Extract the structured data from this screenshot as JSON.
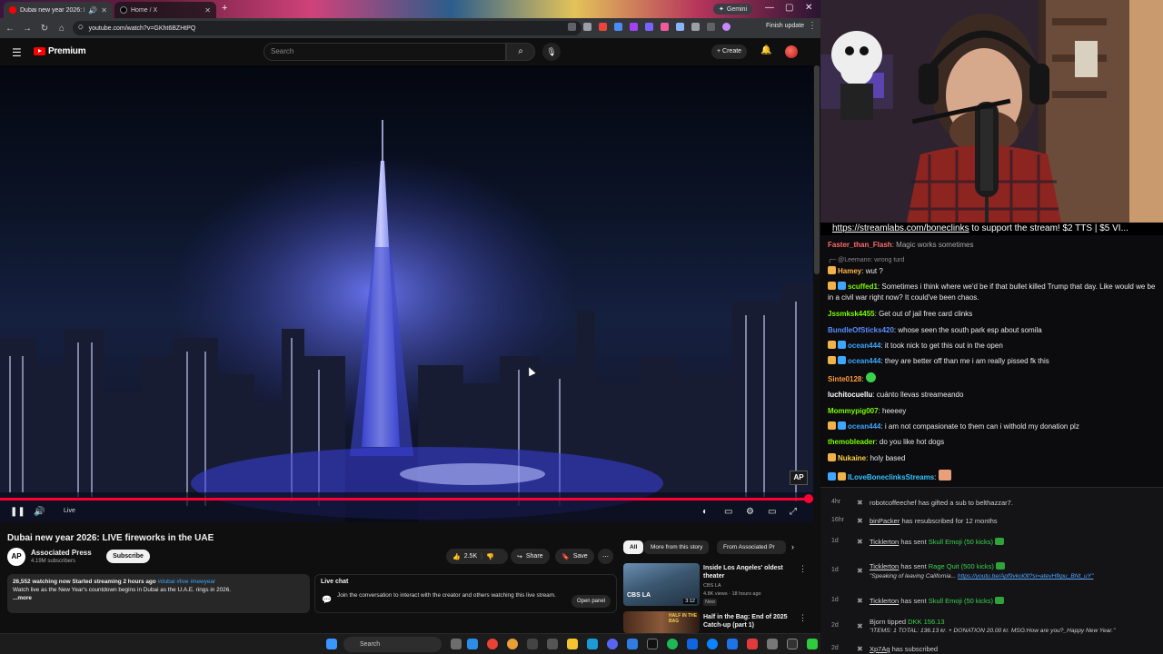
{
  "browser": {
    "tabs": [
      {
        "title": "Dubai new year 2026: LIVE"
      },
      {
        "title": "Home / X"
      }
    ],
    "gemini_label": "Gemini",
    "url": "youtube.com/watch?v=GKht6BZHtPQ",
    "finish_update": "Finish update"
  },
  "youtube": {
    "brand": "Premium",
    "search_placeholder": "Search",
    "create_label": "Create",
    "video": {
      "title": "Dubai new year 2026: LIVE fireworks in the UAE",
      "live_label": "Live",
      "watermark": "AP",
      "progress_fraction": 1.0
    },
    "channel": {
      "avatar_text": "AP",
      "name": "Associated Press",
      "subscribers": "4.19M subscribers",
      "subscribe_label": "Subscribe"
    },
    "actions": {
      "likes": "2.5K",
      "share": "Share",
      "save": "Save"
    },
    "description": {
      "meta": "26,552 watching now  Started streaming 2 hours ago",
      "tags": "#dubai #live #newyear",
      "text": "Watch live as the New Year's countdown begins in Dubai as the U.A.E. rings in 2026.",
      "more": "...more"
    },
    "live_chat": {
      "title": "Live chat",
      "text": "Join the conversation to interact with the creator and others watching this live stream.",
      "open_panel": "Open panel"
    },
    "chips": [
      "All",
      "More from this story",
      "From Associated Pr"
    ],
    "recommendations": [
      {
        "title": "Inside Los Angeles' oldest theater",
        "channel": "CBS LA",
        "meta": "4.8K views · 18 hours ago",
        "badge": "New",
        "duration": "3:12",
        "thumb_text": "CBS LA"
      },
      {
        "title": "Half in the Bag: End of 2025 Catch-up (part 1)",
        "thumb_text": "HALF IN THE BAG"
      }
    ]
  },
  "stream": {
    "ticker_link": "https://streamlabs.com/boneclinks",
    "ticker_text": " to support the stream! $2 TTS | $5 VI..."
  },
  "chat": {
    "messages": [
      {
        "user": "Faster_than_Flash",
        "text": "Magic works sometimes",
        "color": "#ff6b6b"
      },
      {
        "reply": "@Leemann: wrong turd"
      },
      {
        "user": "Hamey",
        "text": "wut ?",
        "color": "#ffb347"
      },
      {
        "user": "scuffed1",
        "text": "Sometimes i think where we'd be if that bullet killed Trump that day. Like would we be in a civil war right now? It could've been chaos.",
        "color": "#7cfc00"
      },
      {
        "user": "Jssmksk4455",
        "text": "Get out of jail free card clinks",
        "color": "#7cfc00"
      },
      {
        "user": "BundleOfSticks420",
        "text": "whose seen the south park esp about somila",
        "color": "#5b8cff"
      },
      {
        "user": "ocean444",
        "text": "it took nick to get this out in the open",
        "color": "#3ea6ff"
      },
      {
        "user": "ocean444",
        "text": "they are better off than me i am really pissed fk this",
        "color": "#3ea6ff"
      },
      {
        "user": "Sinte0128",
        "text": "",
        "color": "#ff9a3c"
      },
      {
        "user": "luchitocuellu",
        "text": "cuánto llevas streameando",
        "color": "#ffffff"
      },
      {
        "user": "Mommypig007",
        "text": "heeeey",
        "color": "#7cfc00"
      },
      {
        "user": "ocean444",
        "text": "i am not compasionate to them can i withold my donation plz",
        "color": "#3ea6ff"
      },
      {
        "user": "themobleader",
        "text": "do you like hot dogs",
        "color": "#7cfc00"
      },
      {
        "user": "Nukaine",
        "text": "holy based",
        "color": "#ffd23f"
      },
      {
        "user": "ILoveBoneclinksStreams",
        "text": "",
        "color": "#34c3ff"
      }
    ]
  },
  "events": [
    {
      "time": "4hr",
      "name": "robotcoffeechef",
      "text": " has gifted a sub to ",
      "target": "belthazzar7."
    },
    {
      "time": "16hr",
      "name": "binPacker",
      "text": " has resubscribed for 12 months"
    },
    {
      "time": "1d",
      "name": "Ticklerton",
      "text": " has sent ",
      "gift": "Skull Emoji (50 kicks)"
    },
    {
      "time": "1d",
      "name": "Ticklerton",
      "text": " has sent ",
      "gift": "Rage Quit (500 kicks)",
      "sub": "\"Speaking of leaving California...",
      "sub_link": "https://youtu.be/Apf9vkol0ll?si=atevHfkpu_BNt_uY\""
    },
    {
      "time": "1d",
      "name": "Ticklerton",
      "text": " has sent ",
      "gift": "Skull Emoji (50 kicks)"
    },
    {
      "time": "2d",
      "name": "Bjorn",
      "text": " tipped ",
      "gift": "DKK 156.13",
      "sub": "\"ITEMS: 1 TOTAL: 136.13 kr. + DONATION 20.00 kr. MSG:How are you?_Happy New Year.\""
    },
    {
      "time": "2d",
      "name": "Xp7Ag",
      "text": " has subscribed"
    }
  ],
  "taskbar": {
    "search_label": "Search"
  },
  "colors": {
    "youtube_red": "#ff0000",
    "progress_red": "#ff0033",
    "kick_green": "#3bd14b",
    "link_blue": "#3ea6ff"
  },
  "icons": [
    "hamburger-icon",
    "search-icon",
    "mic-icon",
    "bell-icon",
    "pause-icon",
    "volume-icon",
    "settings-icon",
    "fullscreen-icon",
    "like-icon",
    "dislike-icon",
    "share-icon",
    "save-icon",
    "windows-start-icon"
  ]
}
